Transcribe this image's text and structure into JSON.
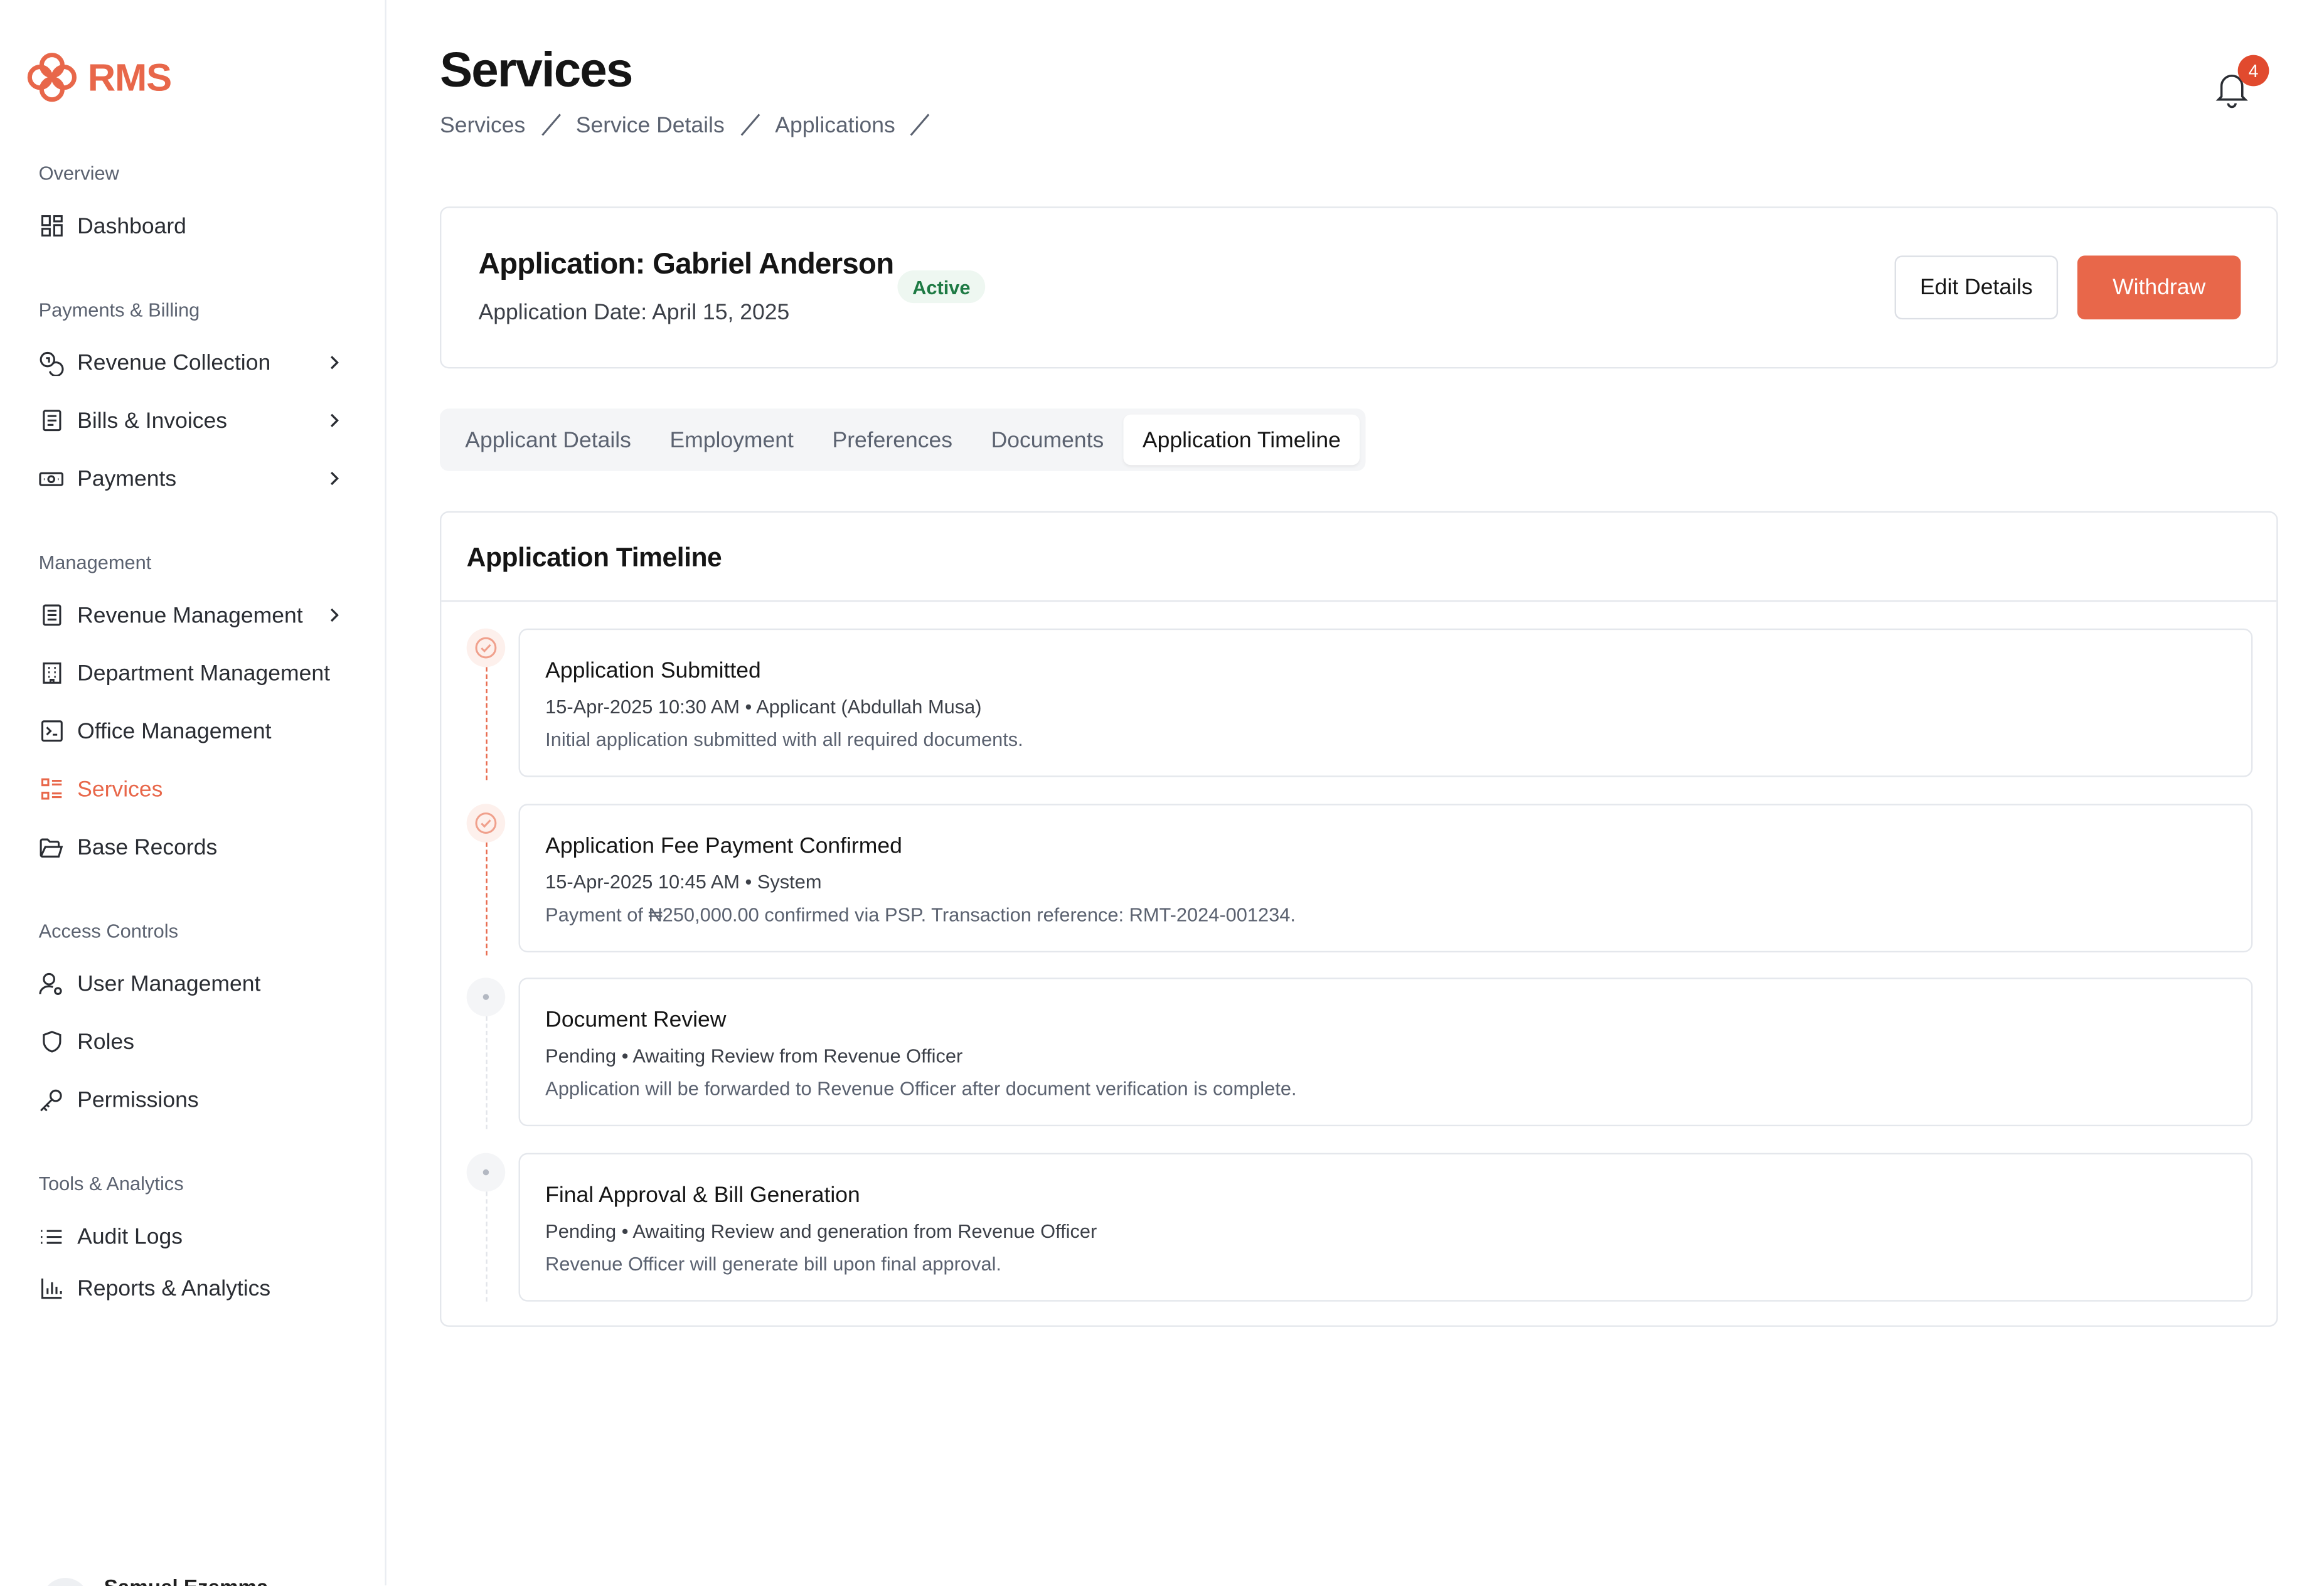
{
  "app": {
    "name": "RMS"
  },
  "colors": {
    "accent": "#e8674a",
    "success": "#1e7a44",
    "badge_bg": "#eef7f1"
  },
  "sidebar": {
    "sections": [
      {
        "label": "Overview"
      },
      {
        "label": "Payments & Billing"
      },
      {
        "label": "Management"
      },
      {
        "label": "Access Controls"
      },
      {
        "label": "Tools & Analytics"
      }
    ],
    "items": [
      {
        "label": "Dashboard",
        "icon": "dashboard-icon"
      },
      {
        "label": "Revenue Collection",
        "icon": "coins-icon",
        "has_children": true
      },
      {
        "label": "Bills & Invoices",
        "icon": "receipt-icon",
        "has_children": true
      },
      {
        "label": "Payments",
        "icon": "banknote-icon",
        "has_children": true
      },
      {
        "label": "Revenue Management",
        "icon": "document-icon",
        "has_children": true
      },
      {
        "label": "Department Management",
        "icon": "building-icon"
      },
      {
        "label": "Office Management",
        "icon": "terminal-icon"
      },
      {
        "label": "Services",
        "icon": "list-icon",
        "active": true
      },
      {
        "label": "Base Records",
        "icon": "folder-icon"
      },
      {
        "label": "User Management",
        "icon": "user-gear-icon"
      },
      {
        "label": "Roles",
        "icon": "shield-icon"
      },
      {
        "label": "Permissions",
        "icon": "key-icon"
      },
      {
        "label": "Audit Logs",
        "icon": "list-bullet-icon"
      },
      {
        "label": "Reports & Analytics",
        "icon": "bar-chart-icon"
      }
    ],
    "user": {
      "name": "Samuel Ezemma"
    }
  },
  "header": {
    "title": "Services",
    "breadcrumb": [
      "Services",
      "Service Details",
      "Applications"
    ],
    "notifications_count": "4"
  },
  "application": {
    "title": "Application: Gabriel Anderson",
    "date": "Application Date: April 15, 2025",
    "status": "Active",
    "edit_label": "Edit Details",
    "withdraw_label": "Withdraw"
  },
  "tabs": [
    {
      "label": "Applicant Details"
    },
    {
      "label": "Employment"
    },
    {
      "label": "Preferences"
    },
    {
      "label": "Documents"
    },
    {
      "label": "Application Timeline",
      "active": true
    }
  ],
  "timeline": {
    "heading": "Application Timeline",
    "events": [
      {
        "title": "Application Submitted",
        "meta": "15-Apr-2025 10:30 AM • Applicant (Abdullah Musa)",
        "description": "Initial application submitted with all required documents.",
        "status": "done"
      },
      {
        "title": "Application Fee Payment Confirmed",
        "meta": "15-Apr-2025 10:45 AM • System",
        "description": "Payment of ₦250,000.00 confirmed via PSP. Transaction reference: RMT-2024-001234.",
        "status": "done"
      },
      {
        "title": "Document Review",
        "meta": "Pending • Awaiting Review from Revenue Officer",
        "description": "Application will be forwarded to Revenue Officer after document verification is complete.",
        "status": "pending"
      },
      {
        "title": "Final Approval & Bill Generation",
        "meta": "Pending • Awaiting Review and generation from Revenue Officer",
        "description": "Revenue Officer will generate bill upon final approval.",
        "status": "pending"
      }
    ]
  }
}
